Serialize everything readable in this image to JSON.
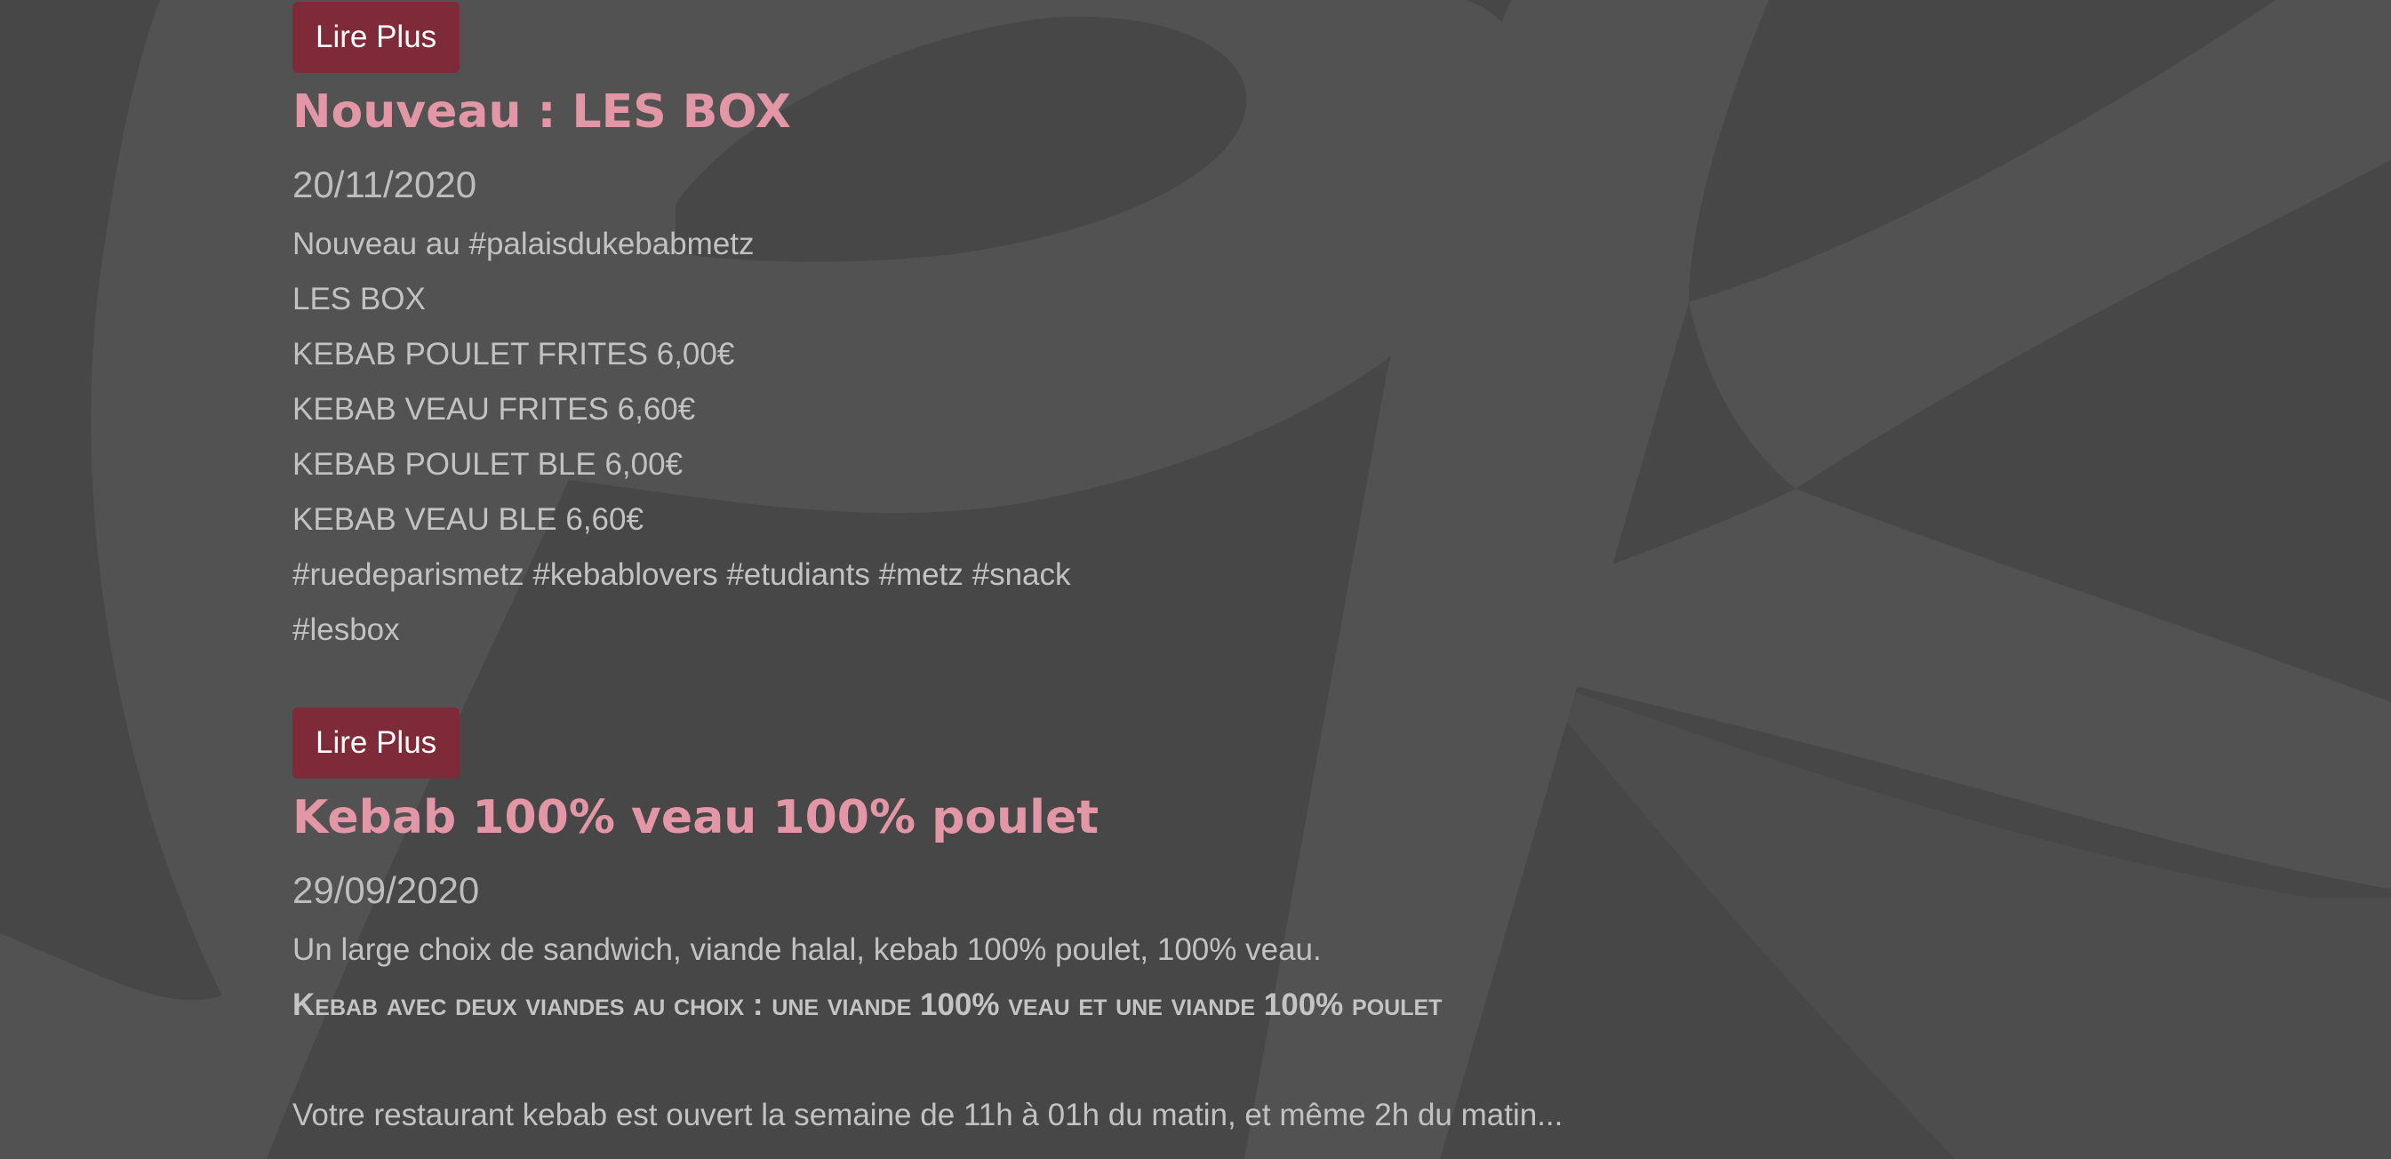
{
  "articles": [
    {
      "button_label": "Lire Plus",
      "title": "Nouveau : LES BOX",
      "date": "20/11/2020",
      "lines": [
        "Nouveau au #palaisdukebabmetz",
        "LES BOX",
        "KEBAB POULET FRITES 6,00€",
        "KEBAB VEAU FRITES 6,60€",
        "KEBAB POULET BLE 6,00€",
        "KEBAB VEAU BLE 6,60€",
        "#ruedeparismetz #kebablovers #etudiants #metz #snack",
        "#lesbox"
      ]
    },
    {
      "button_label": "Lire Plus",
      "title": "Kebab 100% veau 100% poulet",
      "date": "29/09/2020",
      "lines": [
        "Un large choix de sandwich, viande halal, kebab 100% poulet, 100% veau.",
        "Kebab avec deux viandes au choix : une viande 100% veau et une viande 100% poulet",
        "Votre restaurant kebab est ouvert la semaine de 11h à 01h du matin, et même 2h du matin..."
      ]
    }
  ],
  "colors": {
    "background": "#474747",
    "logo_watermark": "#525252",
    "button_bg": "#7f2a38",
    "title": "#e397a6",
    "text": "#c2c2c2"
  },
  "icons": {
    "background_logo": "pk-monogram-watermark"
  }
}
